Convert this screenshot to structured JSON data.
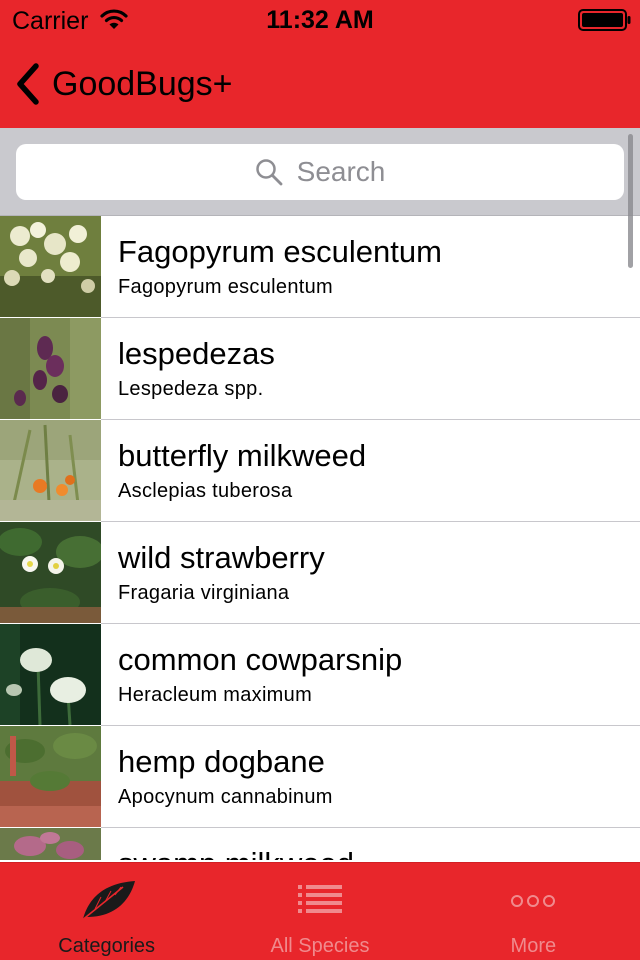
{
  "status_bar": {
    "carrier": "Carrier",
    "time": "11:32 AM"
  },
  "nav": {
    "back_label": "GoodBugs+"
  },
  "search": {
    "placeholder": "Search"
  },
  "list": {
    "items": [
      {
        "title": "Fagopyrum esculentum",
        "subtitle": "Fagopyrum esculentum"
      },
      {
        "title": "lespedezas",
        "subtitle": "Lespedeza spp."
      },
      {
        "title": "butterfly milkweed",
        "subtitle": "Asclepias tuberosa"
      },
      {
        "title": "wild strawberry",
        "subtitle": "Fragaria virginiana"
      },
      {
        "title": "common cowparsnip",
        "subtitle": "Heracleum maximum"
      },
      {
        "title": "hemp dogbane",
        "subtitle": "Apocynum cannabinum"
      },
      {
        "title": "swamp milkweed",
        "subtitle": ""
      }
    ]
  },
  "tabs": [
    {
      "label": "Categories",
      "icon": "leaf-icon",
      "active": true
    },
    {
      "label": "All Species",
      "icon": "list-icon",
      "active": false
    },
    {
      "label": "More",
      "icon": "more-icon",
      "active": false
    }
  ],
  "colors": {
    "brand_red": "#e8262b",
    "search_background": "#c9c9ce",
    "inactive_tab": "#f08a8d"
  }
}
